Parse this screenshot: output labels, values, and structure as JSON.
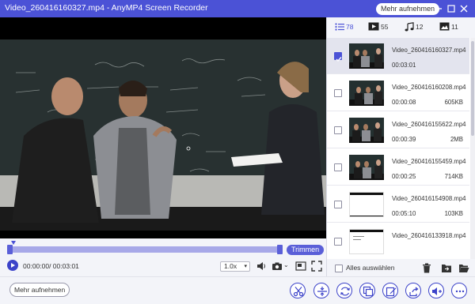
{
  "window": {
    "title": "Video_260416160327.mp4 - AnyMP4 Screen Recorder",
    "record_button": "Mehr aufnehmen"
  },
  "player": {
    "trim_button": "Trimmen",
    "time": "00:00:00/ 00:03:01",
    "speed": "1.0x"
  },
  "tabs": [
    {
      "icon": "list-icon",
      "count": "78"
    },
    {
      "icon": "video-icon",
      "count": "55"
    },
    {
      "icon": "music-icon",
      "count": "12"
    },
    {
      "icon": "image-icon",
      "count": "11"
    }
  ],
  "files": [
    {
      "name": "Video_260416160327.mp4",
      "duration": "00:03:01",
      "size": "",
      "selected": true
    },
    {
      "name": "Video_260416160208.mp4",
      "duration": "00:00:08",
      "size": "605KB",
      "selected": false
    },
    {
      "name": "Video_260416155622.mp4",
      "duration": "00:00:39",
      "size": "2MB",
      "selected": false
    },
    {
      "name": "Video_260416155459.mp4",
      "duration": "00:00:25",
      "size": "714KB",
      "selected": false
    },
    {
      "name": "Video_260416154908.mp4",
      "duration": "00:05:10",
      "size": "103KB",
      "selected": false
    },
    {
      "name": "Video_260416133918.mp4",
      "duration": "",
      "size": "",
      "selected": false
    }
  ],
  "panel": {
    "select_all": "Alles auswählen"
  },
  "bottom": {
    "record_button": "Mehr aufnehmen"
  },
  "colors": {
    "accent": "#4b52d6",
    "trim_track": "#a7a8e8"
  }
}
